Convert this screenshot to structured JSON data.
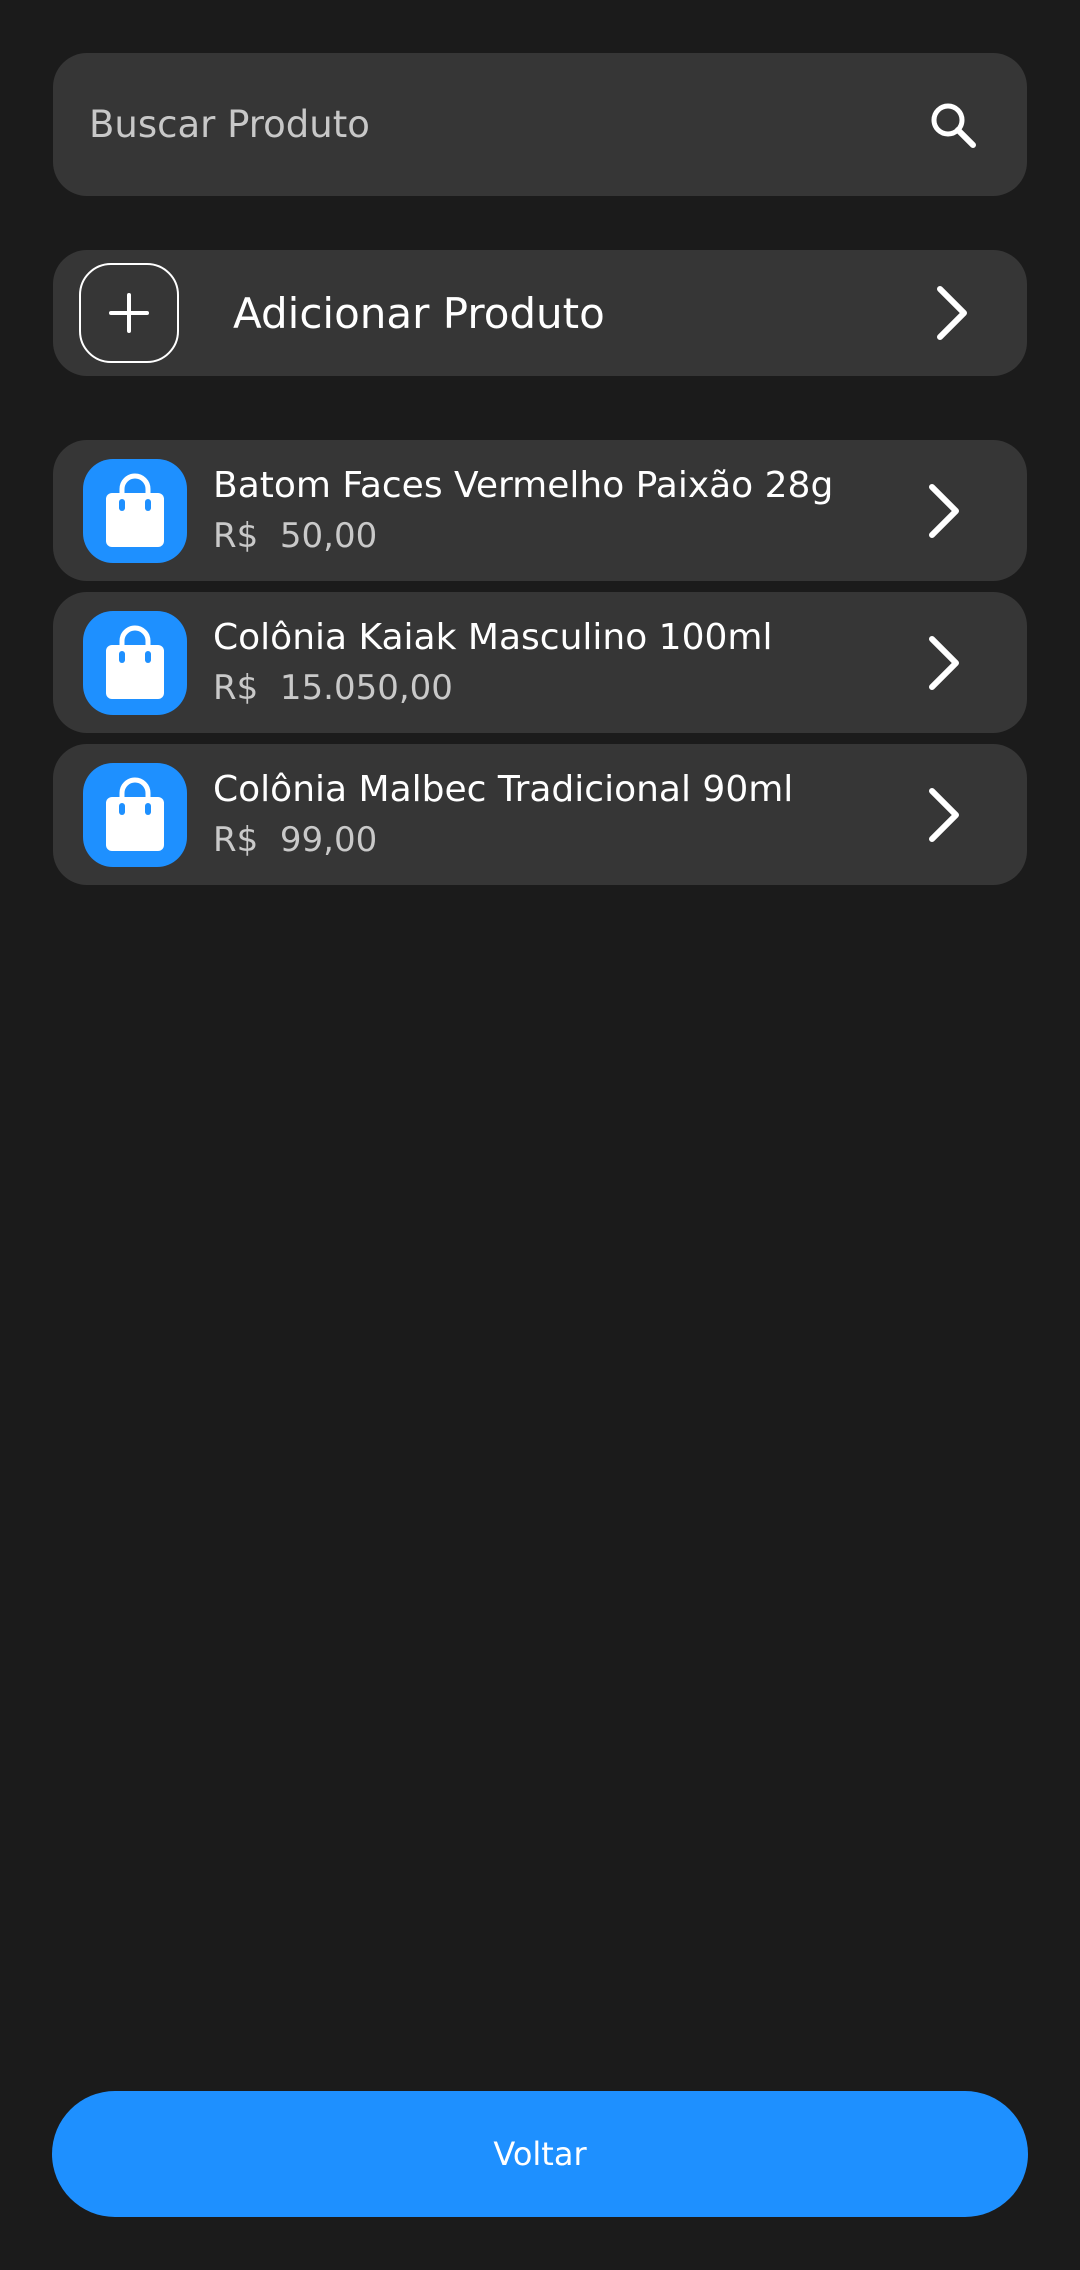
{
  "search": {
    "placeholder": "Buscar Produto",
    "value": "",
    "icon": "search-icon"
  },
  "add_product": {
    "label": "Adicionar Produto",
    "icon": "plus-icon",
    "chevron_icon": "chevron-right-icon"
  },
  "products": [
    {
      "name": "Batom Faces Vermelho Paixão 28g",
      "price": "R$  50,00",
      "icon": "shopping-bag-icon"
    },
    {
      "name": "Colônia Kaiak Masculino 100ml",
      "price": "R$  15.050,00",
      "icon": "shopping-bag-icon"
    },
    {
      "name": "Colônia Malbec Tradicional 90ml",
      "price": "R$  99,00",
      "icon": "shopping-bag-icon"
    }
  ],
  "footer": {
    "back_label": "Voltar"
  },
  "colors": {
    "background": "#1b1b1b",
    "card": "#363636",
    "accent": "#1e90ff",
    "text_primary": "#ffffff",
    "text_secondary": "#c9c9c9"
  }
}
